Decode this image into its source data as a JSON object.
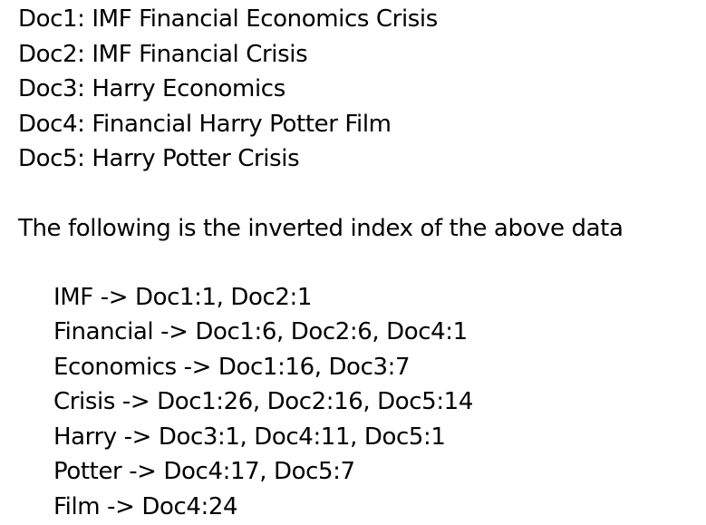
{
  "documents": [
    "Doc1: IMF Financial Economics Crisis",
    "Doc2: IMF Financial Crisis",
    "Doc3: Harry Economics",
    "Doc4: Financial Harry Potter Film",
    "Doc5: Harry Potter Crisis"
  ],
  "intro": "The following is the inverted index of the above data",
  "inverted_index": [
    "IMF -> Doc1:1, Doc2:1",
    "Financial -> Doc1:6, Doc2:6, Doc4:1",
    "Economics -> Doc1:16, Doc3:7",
    "Crisis -> Doc1:26, Doc2:16, Doc5:14",
    "Harry -> Doc3:1, Doc4:11, Doc5:1",
    "Potter -> Doc4:17, Doc5:7",
    "Film -> Doc4:24"
  ]
}
